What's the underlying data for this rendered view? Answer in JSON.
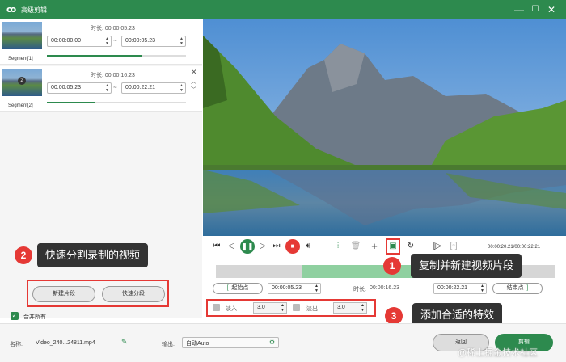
{
  "window": {
    "title": "高级剪辑",
    "logo": "ꝏ",
    "minimize": "—",
    "maximize": "☐",
    "close": "✕"
  },
  "segments": [
    {
      "label": "Segment[1]",
      "duration_label": "时长:",
      "duration": "00:00:05.23",
      "start": "00:00:00.00",
      "end": "00:00:05.23",
      "progress": 0.68
    },
    {
      "label": "Segment[2]",
      "duration_label": "时长:",
      "duration": "00:00:16.23",
      "start": "00:00:05.23",
      "end": "00:00:22.21",
      "progress": 0.35,
      "badge": "2"
    }
  ],
  "annotations": {
    "a1": {
      "num": "1",
      "text": "复制并新建视频片段"
    },
    "a2": {
      "num": "2",
      "text": "快速分割录制的视频"
    },
    "a3": {
      "num": "3",
      "text": "添加合适的特效"
    }
  },
  "left_actions": {
    "new_segment": "新建片段",
    "quick_split": "快速分段",
    "merge_all": "合并所有"
  },
  "player": {
    "time_display": "00:00:20.21/00:00:22.21"
  },
  "trim": {
    "start_button": "起始点",
    "start_value": "00:00:05.23",
    "duration_label": "时长:",
    "duration_value": "00:00:16.23",
    "end_value": "00:00:22.21",
    "end_button": "结束点"
  },
  "effects": {
    "fade_in_label": "淡入",
    "fade_in_value": "3.0",
    "fade_out_label": "淡出",
    "fade_out_value": "3.0"
  },
  "footer": {
    "name_label": "名称:",
    "file_name": "Video_240...24811.mp4",
    "output_label": "输出:",
    "output_value": "自动Auto",
    "back_button": "返回",
    "clip_button": "剪辑"
  },
  "watermark": "@稀土掘金技术社区",
  "colors": {
    "accent": "#2d8a4e",
    "annotation_red": "#e53935",
    "callout_bg": "#333333"
  }
}
